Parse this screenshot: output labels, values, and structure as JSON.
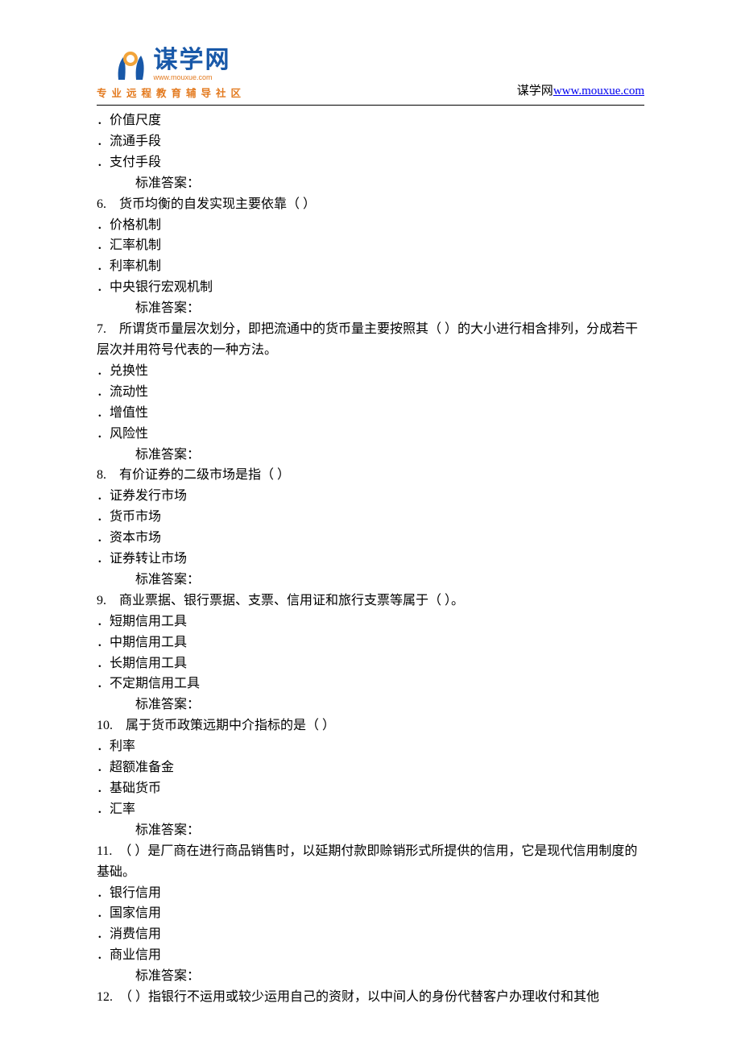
{
  "header": {
    "logo_name": "谋学网",
    "logo_url": "www.mouxue.com",
    "logo_tagline": "专业远程教育辅导社区",
    "right_prefix": "谋学网",
    "right_link_text": "www.mouxue.com",
    "right_link_href": "http://www.mouxue.com"
  },
  "lines": [
    {
      "cls": "opt",
      "text": "．价值尺度"
    },
    {
      "cls": "opt",
      "text": "．流通手段"
    },
    {
      "cls": "opt",
      "text": "．支付手段"
    },
    {
      "cls": "ans",
      "text": "标准答案："
    },
    {
      "cls": "q",
      "text": "6.　货币均衡的自发实现主要依靠（ ）"
    },
    {
      "cls": "opt",
      "text": "．价格机制"
    },
    {
      "cls": "opt",
      "text": "．汇率机制"
    },
    {
      "cls": "opt",
      "text": "．利率机制"
    },
    {
      "cls": "opt",
      "text": "．中央银行宏观机制"
    },
    {
      "cls": "ans",
      "text": "标准答案："
    },
    {
      "cls": "q",
      "text": "7.　所谓货币量层次划分，即把流通中的货币量主要按照其（ ）的大小进行相含排列，分成若干层次并用符号代表的一种方法。"
    },
    {
      "cls": "opt",
      "text": "．兑换性"
    },
    {
      "cls": "opt",
      "text": "．流动性"
    },
    {
      "cls": "opt",
      "text": "．增值性"
    },
    {
      "cls": "opt",
      "text": "．风险性"
    },
    {
      "cls": "ans",
      "text": "标准答案："
    },
    {
      "cls": "q",
      "text": "8.　有价证券的二级市场是指（ ）"
    },
    {
      "cls": "opt",
      "text": "．证券发行市场"
    },
    {
      "cls": "opt",
      "text": "．货币市场"
    },
    {
      "cls": "opt",
      "text": "．资本市场"
    },
    {
      "cls": "opt",
      "text": "．证券转让市场"
    },
    {
      "cls": "ans",
      "text": "标准答案："
    },
    {
      "cls": "q",
      "text": "9.　商业票据、银行票据、支票、信用证和旅行支票等属于（ ）。"
    },
    {
      "cls": "opt",
      "text": "．短期信用工具"
    },
    {
      "cls": "opt",
      "text": "．中期信用工具"
    },
    {
      "cls": "opt",
      "text": "．长期信用工具"
    },
    {
      "cls": "opt",
      "text": "．不定期信用工具"
    },
    {
      "cls": "ans",
      "text": "标准答案："
    },
    {
      "cls": "q",
      "text": "10.　属于货币政策远期中介指标的是（ ）"
    },
    {
      "cls": "opt",
      "text": "．利率"
    },
    {
      "cls": "opt",
      "text": "．超额准备金"
    },
    {
      "cls": "opt",
      "text": "．基础货币"
    },
    {
      "cls": "opt",
      "text": "．汇率"
    },
    {
      "cls": "ans",
      "text": "标准答案："
    },
    {
      "cls": "q",
      "text": "11.　（ ）是厂商在进行商品销售时，以延期付款即赊销形式所提供的信用，它是现代信用制度的基础。"
    },
    {
      "cls": "opt",
      "text": "．银行信用"
    },
    {
      "cls": "opt",
      "text": "．国家信用"
    },
    {
      "cls": "opt",
      "text": "．消费信用"
    },
    {
      "cls": "opt",
      "text": "．商业信用"
    },
    {
      "cls": "ans",
      "text": "标准答案："
    },
    {
      "cls": "q",
      "text": "12.　（ ）指银行不运用或较少运用自己的资财，以中间人的身份代替客户办理收付和其他"
    }
  ]
}
